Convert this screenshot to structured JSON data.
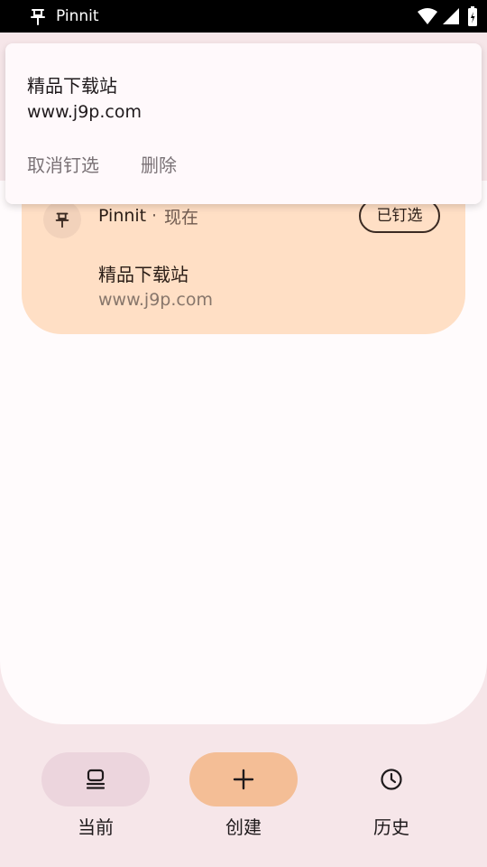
{
  "status_bar": {
    "app_name": "Pinnit",
    "icons": [
      "pin-icon",
      "wifi-icon",
      "signal-icon",
      "battery-icon"
    ]
  },
  "popup": {
    "title": "精品下载站",
    "subtitle": "www.j9p.com",
    "unpin_label": "取消钉选",
    "delete_label": "删除"
  },
  "card": {
    "app_name": "Pinnit",
    "separator": "·",
    "time": "现在",
    "pinned_label": "已钉选",
    "title": "精品下载站",
    "subtitle": "www.j9p.com"
  },
  "nav": {
    "current_label": "当前",
    "create_label": "创建",
    "history_label": "历史"
  },
  "colors": {
    "card_bg": "#ffdfc5",
    "nav_current_bg": "#ecd5dd",
    "nav_create_bg": "#f4be96",
    "background": "#f6e6e9"
  }
}
